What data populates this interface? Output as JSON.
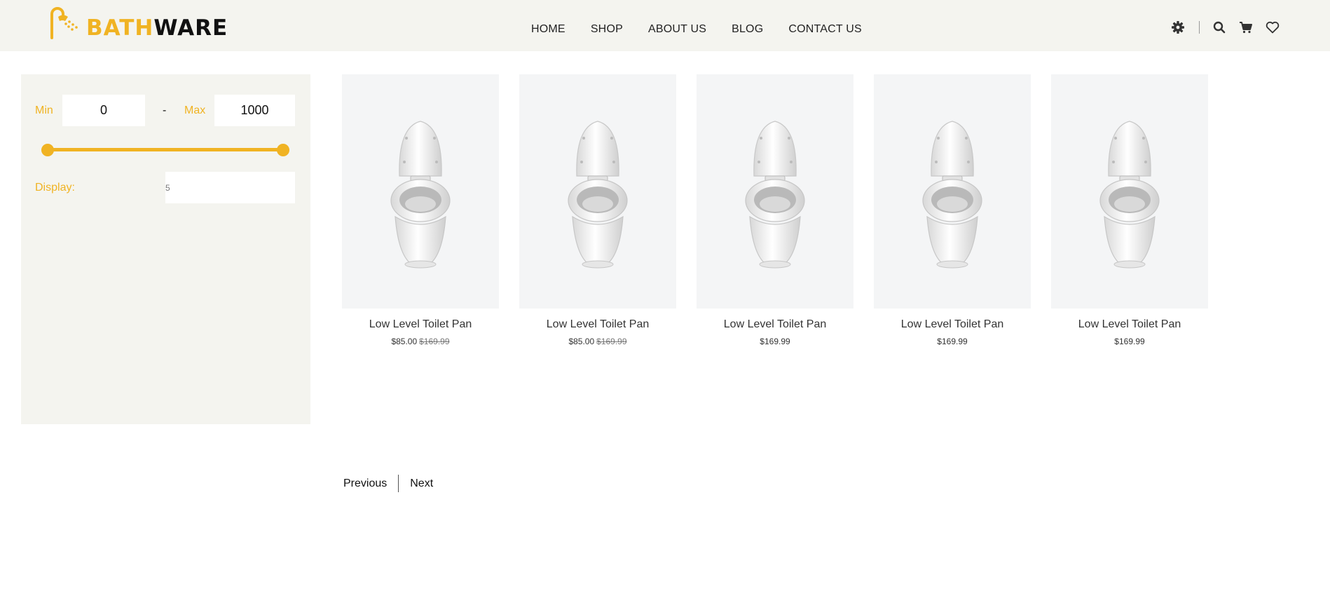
{
  "brand": {
    "part1": "BATH",
    "part2": "WARE",
    "logo_icon": "shower-icon"
  },
  "nav": {
    "items": [
      {
        "label": "HOME"
      },
      {
        "label": "SHOP"
      },
      {
        "label": "ABOUT US"
      },
      {
        "label": "BLOG"
      },
      {
        "label": "CONTACT US"
      }
    ]
  },
  "header_icons": [
    "gear-icon",
    "search-icon",
    "cart-icon",
    "heart-icon"
  ],
  "filter": {
    "min_label": "Min",
    "min_value": "0",
    "dash": "-",
    "max_label": "Max",
    "max_value": "1000",
    "range_fraction": [
      0,
      1
    ],
    "display_label": "Display:",
    "display_value": "5"
  },
  "products": [
    {
      "name": "Low Level Toilet Pan",
      "price": "$85.00",
      "old_price": "$169.99"
    },
    {
      "name": "Low Level Toilet Pan",
      "price": "$85.00",
      "old_price": "$169.99"
    },
    {
      "name": "Low Level Toilet Pan",
      "price": "$169.99",
      "old_price": ""
    },
    {
      "name": "Low Level Toilet Pan",
      "price": "$169.99",
      "old_price": ""
    },
    {
      "name": "Low Level Toilet Pan",
      "price": "$169.99",
      "old_price": ""
    }
  ],
  "pagination": {
    "previous": "Previous",
    "next": "Next"
  },
  "colors": {
    "accent": "#f0b323",
    "header_bg": "#f4f4ef",
    "product_bg": "#f4f5f6"
  }
}
